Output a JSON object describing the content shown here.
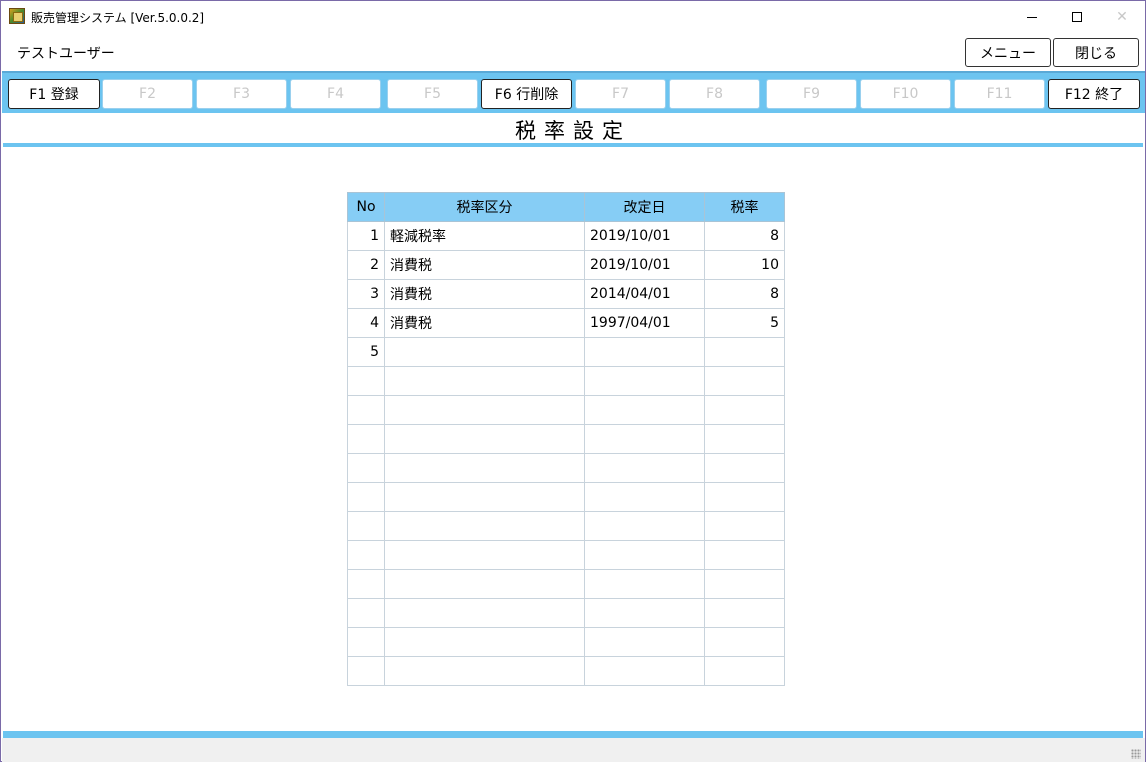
{
  "window": {
    "title": "販売管理システム [Ver.5.0.0.2]",
    "icon": "app-logo-icon",
    "controls": [
      "minimize",
      "maximize",
      "close"
    ]
  },
  "header": {
    "user": "テストユーザー",
    "menu_label": "メニュー",
    "close_label": "閉じる"
  },
  "fkeys": [
    {
      "label": "F1 登録",
      "enabled": true
    },
    {
      "label": "F2",
      "enabled": false
    },
    {
      "label": "F3",
      "enabled": false
    },
    {
      "label": "F4",
      "enabled": false
    },
    {
      "label": "F5",
      "enabled": false
    },
    {
      "label": "F6 行削除",
      "enabled": true
    },
    {
      "label": "F7",
      "enabled": false
    },
    {
      "label": "F8",
      "enabled": false
    },
    {
      "label": "F9",
      "enabled": false
    },
    {
      "label": "F10",
      "enabled": false
    },
    {
      "label": "F11",
      "enabled": false
    },
    {
      "label": "F12 終了",
      "enabled": true
    }
  ],
  "page": {
    "title": "税率設定"
  },
  "table": {
    "headers": [
      "No",
      "税率区分",
      "改定日",
      "税率"
    ],
    "rows": [
      [
        "1",
        "軽減税率",
        "2019/10/01",
        "8"
      ],
      [
        "2",
        "消費税",
        "2019/10/01",
        "10"
      ],
      [
        "3",
        "消費税",
        "2014/04/01",
        "8"
      ],
      [
        "4",
        "消費税",
        "1997/04/01",
        "5"
      ],
      [
        "5",
        "",
        "",
        ""
      ],
      [
        "",
        "",
        "",
        ""
      ],
      [
        "",
        "",
        "",
        ""
      ],
      [
        "",
        "",
        "",
        ""
      ],
      [
        "",
        "",
        "",
        ""
      ],
      [
        "",
        "",
        "",
        ""
      ],
      [
        "",
        "",
        "",
        ""
      ],
      [
        "",
        "",
        "",
        ""
      ],
      [
        "",
        "",
        "",
        ""
      ],
      [
        "",
        "",
        "",
        ""
      ],
      [
        "",
        "",
        "",
        ""
      ],
      [
        "",
        "",
        "",
        ""
      ]
    ]
  },
  "colors": {
    "accent": "#6cc4f0",
    "table_header": "#86cdf5",
    "disabled_text": "#c8c8c8"
  }
}
